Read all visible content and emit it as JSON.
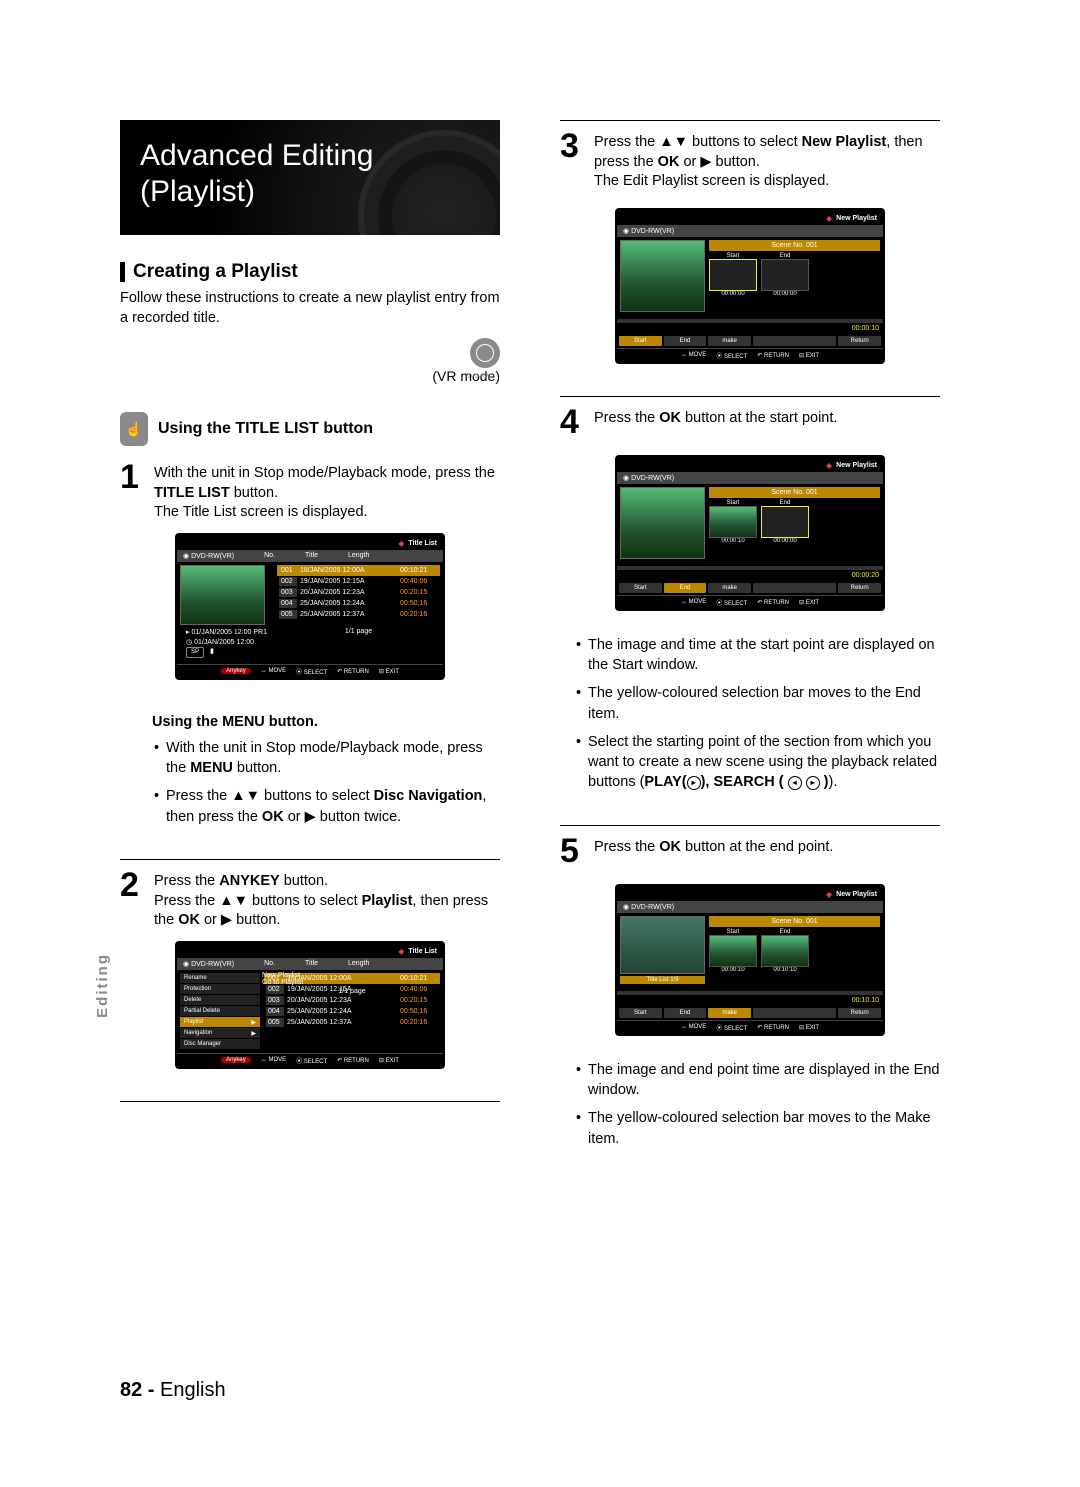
{
  "hero": {
    "title": "Advanced Editing (Playlist)"
  },
  "section": {
    "title": "Creating a Playlist",
    "intro": "Follow these instructions to create a new playlist entry from a recorded title.",
    "mode": "(VR mode)"
  },
  "sub1": {
    "title": "Using the TITLE LIST button"
  },
  "step1": {
    "l1": "With the unit in Stop mode/Playback mode, press the ",
    "b1": "TITLE LIST",
    "l2": " button.",
    "l3": "The Title List screen is displayed."
  },
  "tv1": {
    "title": "Title List",
    "disc": "DVD-RW(VR)",
    "cols": {
      "no": "No.",
      "title": "Title",
      "len": "Length"
    },
    "rows": [
      {
        "no": "001",
        "t": "18/JAN/2005 12:00A",
        "len": "00:10:21"
      },
      {
        "no": "002",
        "t": "19/JAN/2005 12:15A",
        "len": "00:40:06"
      },
      {
        "no": "003",
        "t": "20/JAN/2005 12:23A",
        "len": "00:20:15"
      },
      {
        "no": "004",
        "t": "25/JAN/2005 12:24A",
        "len": "00:50:16"
      },
      {
        "no": "005",
        "t": "25/JAN/2005 12:37A",
        "len": "00:20:16"
      }
    ],
    "info1": "01/JAN/2005 12:00 PR1",
    "info2": "01/JAN/2005 12:00",
    "sp": "SP",
    "page": "1/1 page",
    "foot": {
      "any": "Anykey",
      "move": "MOVE",
      "select": "SELECT",
      "ret": "RETURN",
      "exit": "EXIT"
    }
  },
  "menub": {
    "title": "Using the MENU button.",
    "b1a": "With the unit in Stop mode/Playback mode, press the ",
    "b1b": "MENU",
    "b1c": " button.",
    "b2a": "Press the ▲▼ buttons to select ",
    "b2b": "Disc Navigation",
    "b2c": ", then press the ",
    "b2d": "OK",
    "b2e": " or ▶ button twice."
  },
  "step2": {
    "l1": "Press the ",
    "b1": "ANYKEY",
    "l2": " button.",
    "l3a": "Press the ▲▼ buttons to select ",
    "b2": "Playlist",
    "l3b": ", then press the ",
    "b3": "OK",
    "l3c": " or ▶ button."
  },
  "tv2": {
    "title": "Title List",
    "disc": "DVD-RW(VR)",
    "menu": [
      "Rename",
      "Protection",
      "Delete",
      "Partial Delete",
      "Playlist",
      "Navigation",
      "Disc Manager"
    ],
    "sub": [
      "New Playlist",
      "Go to Playlist"
    ],
    "page": "1/1 page"
  },
  "step3": {
    "l1": "Press the ▲▼ buttons to select ",
    "b1": "New Playlist",
    "l2": ", then press the ",
    "b2": "OK",
    "l3": " or ▶ button.",
    "l4": "The Edit Playlist screen is displayed."
  },
  "np": {
    "title": "New Playlist",
    "disc": "DVD-RW(VR)",
    "scene": "Scene No. 001",
    "start": "Start",
    "end": "End",
    "make": "make",
    "ret": "Return",
    "tlist": "Title List 1/9"
  },
  "tv3": {
    "s": "00:00:00",
    "e": "00:00:00",
    "t": "00:00:10"
  },
  "step4": {
    "l1": "Press the ",
    "b1": "OK",
    "l2": " button at the start point."
  },
  "tv4": {
    "s": "00:00:10",
    "e": "00:00:00",
    "t": "00:00:20"
  },
  "bul4": {
    "a": "The image and time at the start point are displayed on the Start window.",
    "b": "The yellow-coloured selection bar moves to the End item.",
    "c1": "Select the starting point of the section from which you want to create a new scene using the playback related  buttons (",
    "c2": "PLAY(   ), SEARCH (        )",
    "c3": ")."
  },
  "step5": {
    "l1": "Press the ",
    "b1": "OK",
    "l2": " button at the end point."
  },
  "tv5": {
    "s": "00:00:10",
    "e": "00:10:10",
    "t": "00:10:10"
  },
  "bul5": {
    "a": "The image and end point time are displayed in the End window.",
    "b": "The yellow-coloured selection bar moves to the Make item."
  },
  "side": "Editing",
  "footer": {
    "page": "82 - ",
    "lang": "English"
  }
}
